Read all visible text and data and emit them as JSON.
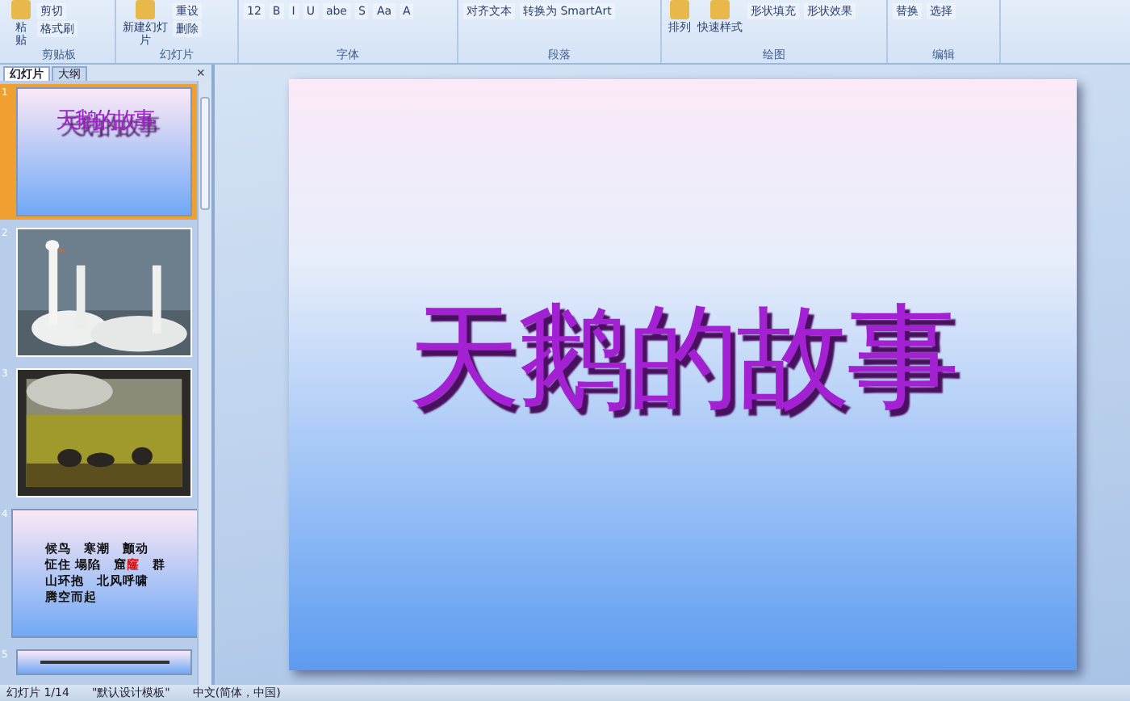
{
  "ribbon": {
    "groups": [
      {
        "label": "剪贴板",
        "big": [
          "粘贴"
        ],
        "small": [
          "剪切",
          "格式刷"
        ]
      },
      {
        "label": "幻灯片",
        "big": [
          "新建幻灯片"
        ],
        "small": [
          "重设",
          "删除"
        ]
      },
      {
        "label": "字体",
        "small": [
          "12",
          "B",
          "I",
          "U",
          "abe",
          "S",
          "Aa",
          "A"
        ]
      },
      {
        "label": "段落",
        "small": [
          "对齐文本",
          "转换为 SmartArt"
        ]
      },
      {
        "label": "绘图",
        "big": [
          "排列",
          "快速样式"
        ],
        "small": [
          "形状填充",
          "形状效果"
        ]
      },
      {
        "label": "编辑",
        "small": [
          "替换",
          "选择"
        ]
      }
    ]
  },
  "pane": {
    "tabs": [
      {
        "label": "幻灯片",
        "selected": true
      },
      {
        "label": "大纲",
        "selected": false
      }
    ],
    "close": "×",
    "slides": [
      {
        "number": "1",
        "kind": "title",
        "selected": true,
        "title": "天鹅的故事"
      },
      {
        "number": "2",
        "selected": false
      },
      {
        "number": "3",
        "selected": false
      },
      {
        "number": "4",
        "kind": "words",
        "selected": false,
        "lines": [
          [
            {
              "text": "候鸟　寒潮　颤动",
              "highlight": false
            }
          ],
          [
            {
              "text": "怔住 塌陷　窟",
              "highlight": false
            },
            {
              "text": "窿",
              "highlight": true
            },
            {
              "text": "　群",
              "highlight": false
            }
          ],
          [
            {
              "text": "山环抱　北风呼啸",
              "highlight": false
            }
          ],
          [
            {
              "text": "腾空而起",
              "highlight": false
            }
          ]
        ]
      },
      {
        "number": "5",
        "kind": "note",
        "selected": false
      }
    ]
  },
  "slide": {
    "title": "天鹅的故事"
  },
  "status_bar": [
    "幻灯片 1/14",
    "\"默认设计模板\"",
    "中文(简体，中国)"
  ]
}
